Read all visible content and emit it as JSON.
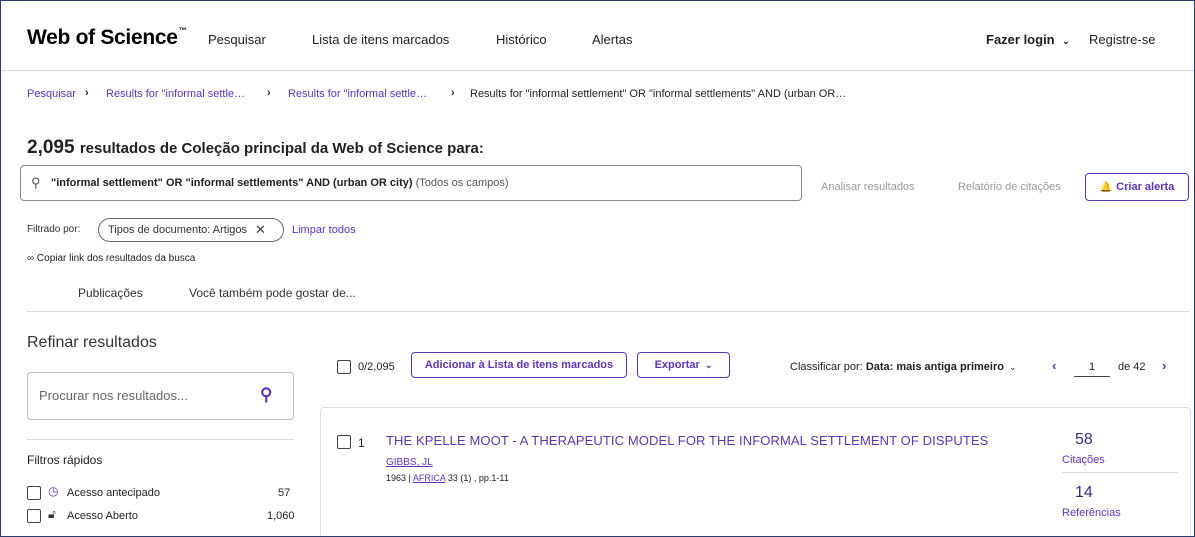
{
  "header": {
    "logo": "Web of Science",
    "logo_tm": "™",
    "nav": [
      "Pesquisar",
      "Lista de itens marcados",
      "Histórico",
      "Alertas"
    ],
    "login": "Fazer login",
    "register": "Registre-se"
  },
  "breadcrumb": {
    "items": [
      "Pesquisar",
      "Results for \"informal settle…",
      "Results for \"informal settle…"
    ],
    "current": "Results for \"informal settlement\" OR \"informal settlements\" AND (urban OR…",
    "sep": "›"
  },
  "summary": {
    "count": "2,095",
    "text": "resultados de Coleção principal da Web of Science para:"
  },
  "search": {
    "query": "\"informal settlement\" OR \"informal settlements\" AND (urban OR city)",
    "fields": "(Todos os campos)",
    "analyze": "Analisar resultados",
    "citation_report": "Relatório de citações",
    "create_alert": "Criar alerta"
  },
  "filters": {
    "label": "Filtrado por:",
    "chip": "Tipos de documento: Artigos",
    "clear_all": "Limpar todos",
    "copy_link": "Copiar link dos resultados da busca"
  },
  "tabs": [
    "Publicações",
    "Você também pode gostar de..."
  ],
  "sidebar": {
    "title": "Refinar resultados",
    "search_placeholder": "Procurar nos resultados...",
    "quick_filters": "Filtros rápidos",
    "items": [
      {
        "label": "Acesso antecipado",
        "count": "57",
        "icon": "clock-icon"
      },
      {
        "label": "Acesso Aberto",
        "count": "1,060",
        "icon": "lock-open-icon"
      }
    ]
  },
  "toolbar": {
    "selected": "0/2,095",
    "add_to_list": "Adicionar à Lista de itens marcados",
    "export": "Exportar",
    "sort_label": "Classificar por:",
    "sort_value": "Data: mais antiga primeiro",
    "page": "1",
    "of_pages": "de 42"
  },
  "results": [
    {
      "index": "1",
      "title": "THE KPELLE MOOT - A THERAPEUTIC MODEL FOR THE INFORMAL SETTLEMENT OF DISPUTES",
      "author": "GIBBS, JL",
      "year": "1963",
      "journal": "AFRICA",
      "details": "33 (1) , pp.1-11",
      "citations": "58",
      "citations_label": "Citações",
      "references": "14",
      "references_label": "Referências"
    }
  ],
  "colors": {
    "accent": "#5e33bf",
    "frame": "#2b3a67"
  }
}
